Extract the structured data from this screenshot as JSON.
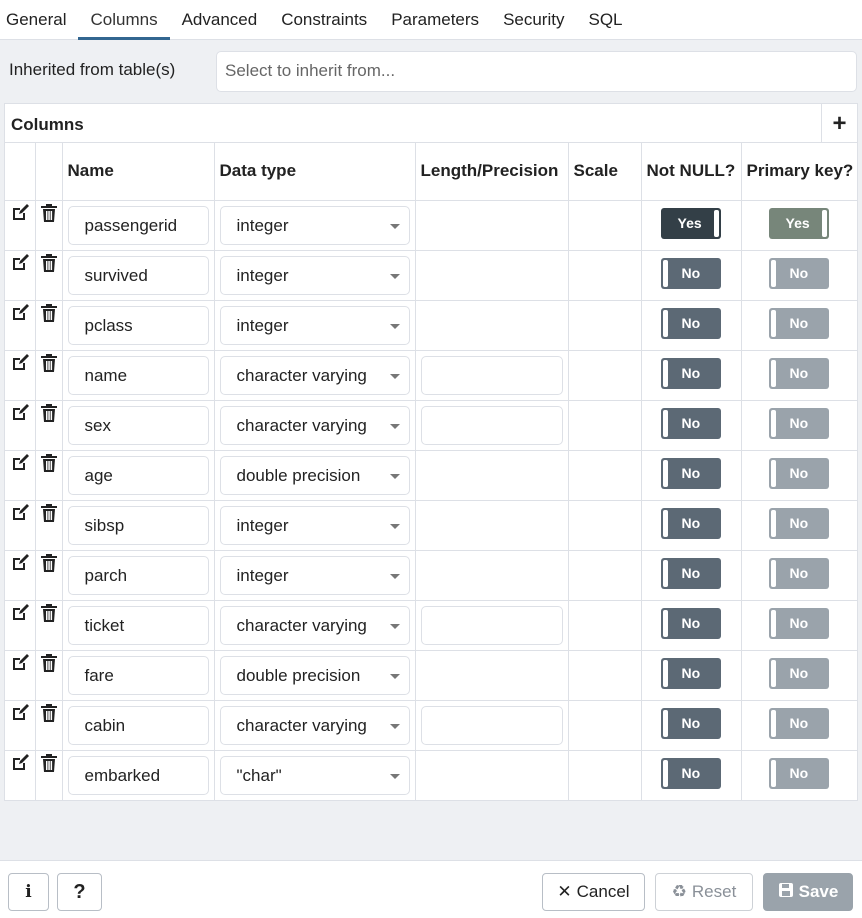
{
  "tabs": [
    {
      "label": "General"
    },
    {
      "label": "Columns",
      "active": true
    },
    {
      "label": "Advanced"
    },
    {
      "label": "Constraints"
    },
    {
      "label": "Parameters"
    },
    {
      "label": "Security"
    },
    {
      "label": "SQL"
    }
  ],
  "inherit": {
    "label": "Inherited from table(s)",
    "placeholder": "Select to inherit from..."
  },
  "grid": {
    "title": "Columns",
    "add_label": "+",
    "headers": {
      "name": "Name",
      "data_type": "Data type",
      "length": "Length/Precision",
      "scale": "Scale",
      "not_null": "Not NULL?",
      "primary_key": "Primary key?"
    },
    "rows": [
      {
        "name": "passengerid",
        "type": "integer",
        "length_editable": false,
        "not_null": "Yes",
        "primary_key": "Yes"
      },
      {
        "name": "survived",
        "type": "integer",
        "length_editable": false,
        "not_null": "No",
        "primary_key": "No"
      },
      {
        "name": "pclass",
        "type": "integer",
        "length_editable": false,
        "not_null": "No",
        "primary_key": "No"
      },
      {
        "name": "name",
        "type": "character varying",
        "length_editable": true,
        "not_null": "No",
        "primary_key": "No"
      },
      {
        "name": "sex",
        "type": "character varying",
        "length_editable": true,
        "not_null": "No",
        "primary_key": "No"
      },
      {
        "name": "age",
        "type": "double precision",
        "length_editable": false,
        "not_null": "No",
        "primary_key": "No"
      },
      {
        "name": "sibsp",
        "type": "integer",
        "length_editable": false,
        "not_null": "No",
        "primary_key": "No"
      },
      {
        "name": "parch",
        "type": "integer",
        "length_editable": false,
        "not_null": "No",
        "primary_key": "No"
      },
      {
        "name": "ticket",
        "type": "character varying",
        "length_editable": true,
        "not_null": "No",
        "primary_key": "No"
      },
      {
        "name": "fare",
        "type": "double precision",
        "length_editable": false,
        "not_null": "No",
        "primary_key": "No"
      },
      {
        "name": "cabin",
        "type": "character varying",
        "length_editable": true,
        "not_null": "No",
        "primary_key": "No"
      },
      {
        "name": "embarked",
        "type": "\"char\"",
        "length_editable": false,
        "not_null": "No",
        "primary_key": "No"
      }
    ]
  },
  "footer": {
    "info_label": "i",
    "help_label": "?",
    "cancel_label": "Cancel",
    "reset_label": "Reset",
    "save_label": "Save"
  },
  "colors": {
    "accent": "#326690",
    "toggle_on": "#333f47",
    "toggle_off": "#5c6975",
    "pk_on": "#77867a",
    "pk_off": "#9aa3ab"
  }
}
